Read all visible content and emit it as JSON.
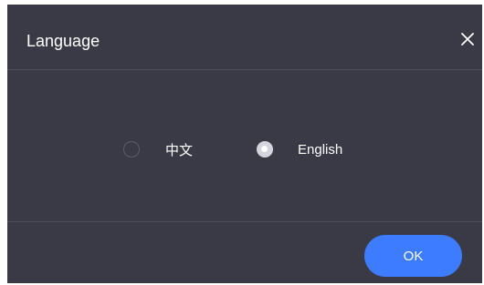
{
  "dialog": {
    "title": "Language",
    "close_icon": "close-icon",
    "options": [
      {
        "label": "中文",
        "selected": false
      },
      {
        "label": "English",
        "selected": true
      }
    ],
    "ok_label": "OK"
  },
  "colors": {
    "dialog_bg": "#3a3a47",
    "divider": "#4d4d5e",
    "text": "#ffffff",
    "radio_unchecked_border": "#5b5b6a",
    "radio_checked": "#d4d4dc",
    "accent": "#3d7cff"
  }
}
